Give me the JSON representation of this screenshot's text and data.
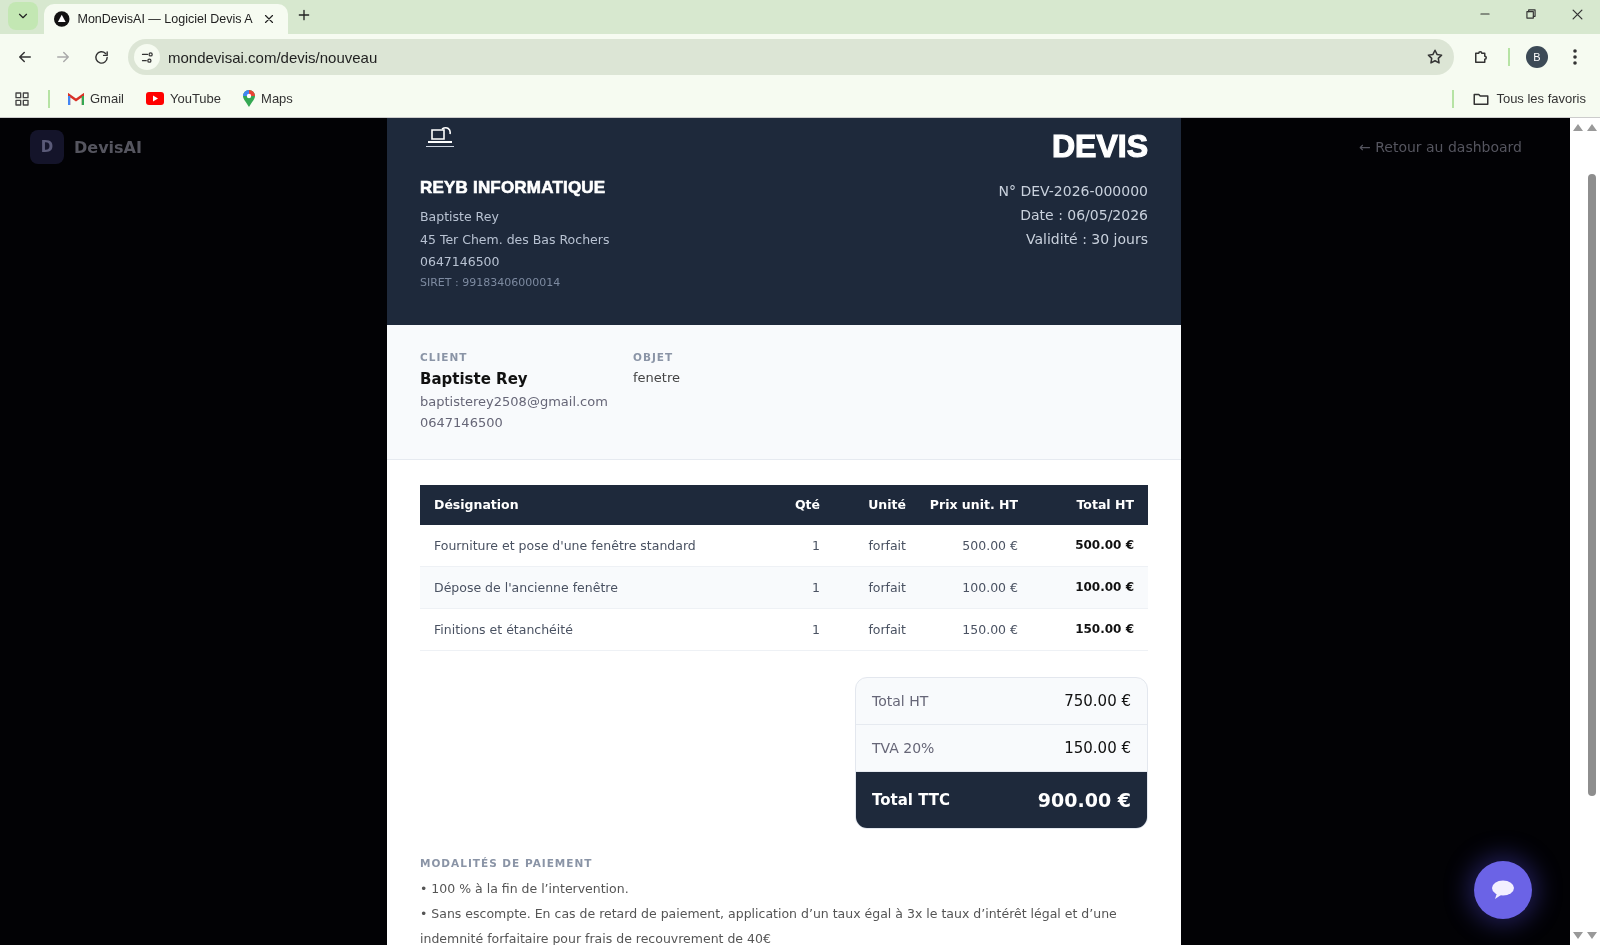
{
  "browser": {
    "tab_title": "MonDevisAI — Logiciel Devis A",
    "url": "mondevisai.com/devis/nouveau",
    "profile": "B",
    "bookmarks": [
      "Gmail",
      "YouTube",
      "Maps"
    ],
    "all_bookmarks": "Tous les favoris"
  },
  "app_header": {
    "logo_letter": "D",
    "brand": "DevisAI",
    "back_link": "← Retour au dashboard"
  },
  "quote": {
    "title": "DEVIS",
    "number": "N° DEV-2026-000000",
    "date": "Date : 06/05/2026",
    "validity": "Validité : 30 jours",
    "company": {
      "name": "REYB INFORMATIQUE",
      "lines": [
        "Baptiste Rey",
        "45 Ter Chem. des Bas Rochers",
        "0647146500"
      ],
      "siret": "SIRET : 99183406000014"
    },
    "client": {
      "label": "CLIENT",
      "name": "Baptiste Rey",
      "email": "baptisterey2508@gmail.com",
      "phone": "0647146500"
    },
    "object": {
      "label": "OBJET",
      "value": "fenetre"
    },
    "table": {
      "columns": [
        "Désignation",
        "Qté",
        "Unité",
        "Prix unit. HT",
        "Total HT"
      ],
      "rows": [
        [
          "Fourniture et pose d'une fenêtre standard",
          "1",
          "forfait",
          "500.00 €",
          "500.00 €"
        ],
        [
          "Dépose de l'ancienne fenêtre",
          "1",
          "forfait",
          "100.00 €",
          "100.00 €"
        ],
        [
          "Finitions et étanchéité",
          "1",
          "forfait",
          "150.00 €",
          "150.00 €"
        ]
      ]
    },
    "totals": [
      {
        "label": "Total HT",
        "value": "750.00 €",
        "kind": "line"
      },
      {
        "label": "TVA 20%",
        "value": "150.00 €",
        "kind": "line"
      },
      {
        "label": "Total TTC",
        "value": "900.00 €",
        "kind": "grand"
      }
    ],
    "payment": {
      "label": "MODALITÉS DE PAIEMENT",
      "lines": [
        "• 100 % à la fin de l’intervention.",
        "• Sans escompte. En cas de retard de paiement, application d’un taux égal à 3x le taux d’intérêt légal et d’une indemnité forfaitaire pour frais de recouvrement de 40€"
      ]
    }
  }
}
